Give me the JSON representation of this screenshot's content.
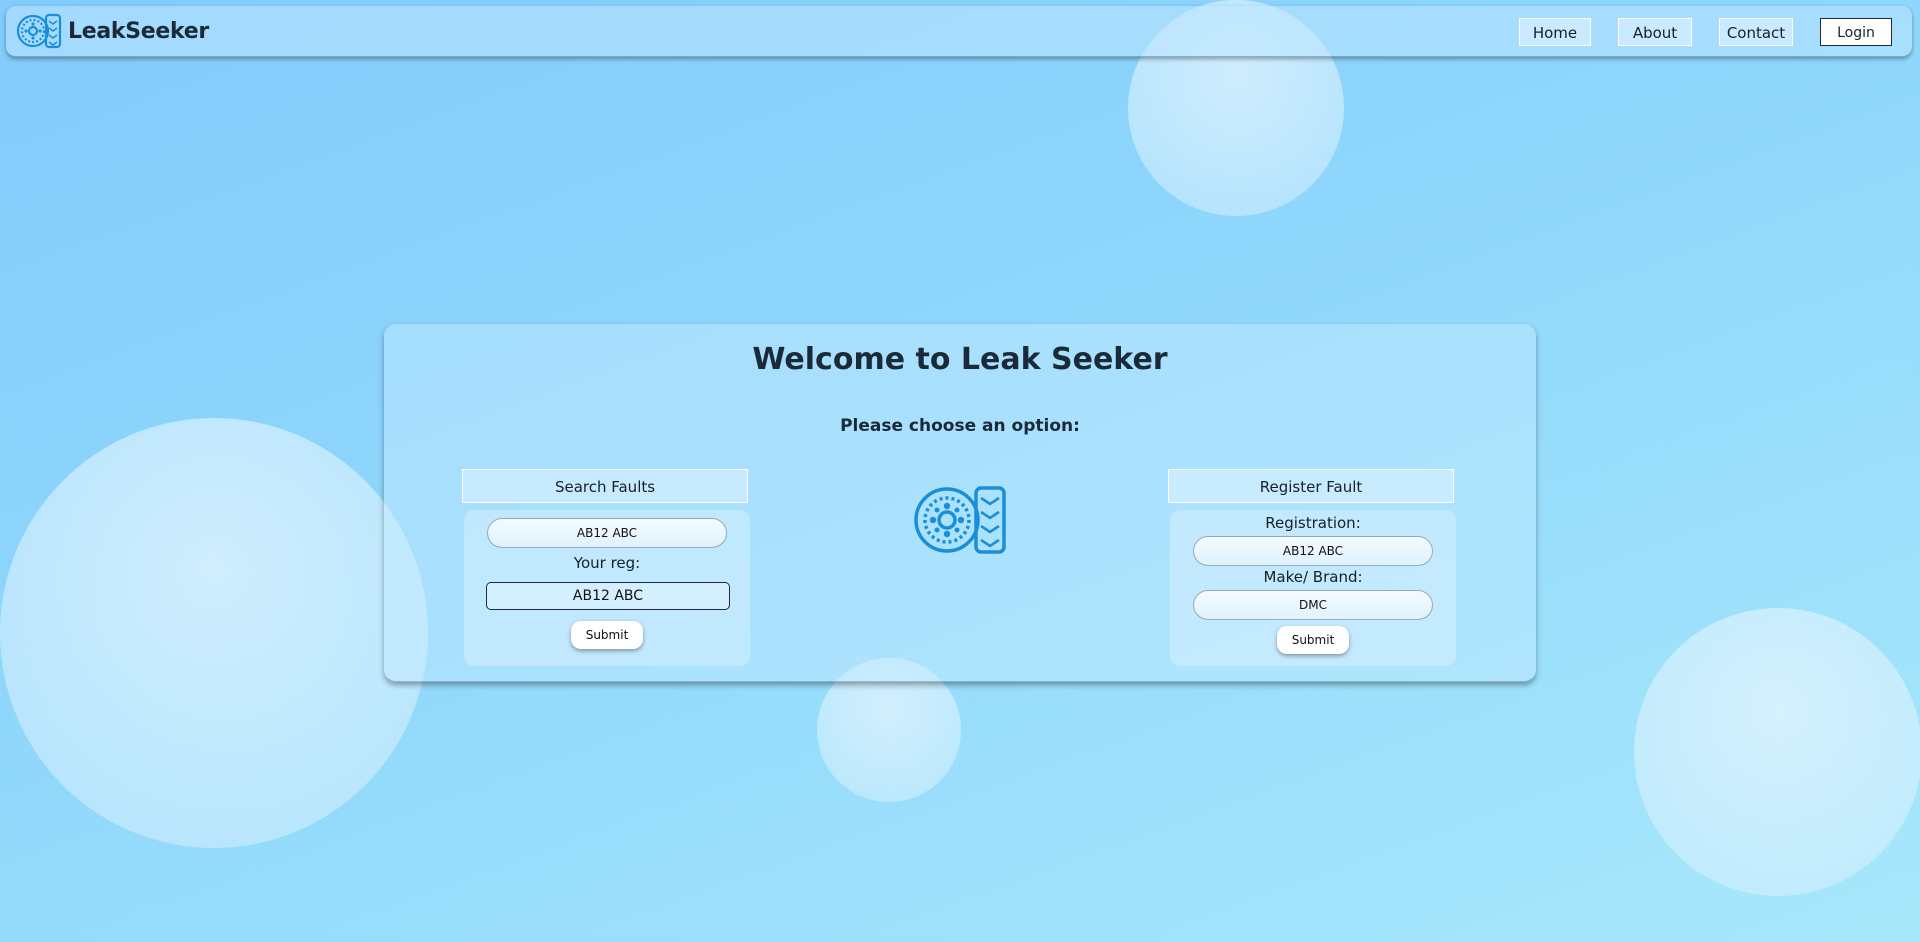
{
  "brand": {
    "name": "LeakSeeker",
    "logo_icon": "tire-wheel-icon",
    "accent": "#1a8fd8"
  },
  "nav": {
    "home": "Home",
    "about": "About",
    "contact": "Contact",
    "login": "Login"
  },
  "main": {
    "title": "Welcome to Leak Seeker",
    "subtitle": "Please choose an option:",
    "center_icon": "tire-wheel-icon",
    "search": {
      "heading": "Search Faults",
      "field_value": "AB12 ABC",
      "reg_label": "Your reg:",
      "reg_value": "AB12 ABC",
      "submit": "Submit"
    },
    "register": {
      "heading": "Register Fault",
      "registration_label": "Registration:",
      "registration_value": "AB12 ABC",
      "make_label": "Make/ Brand:",
      "make_value": "DMC",
      "submit": "Submit"
    }
  }
}
